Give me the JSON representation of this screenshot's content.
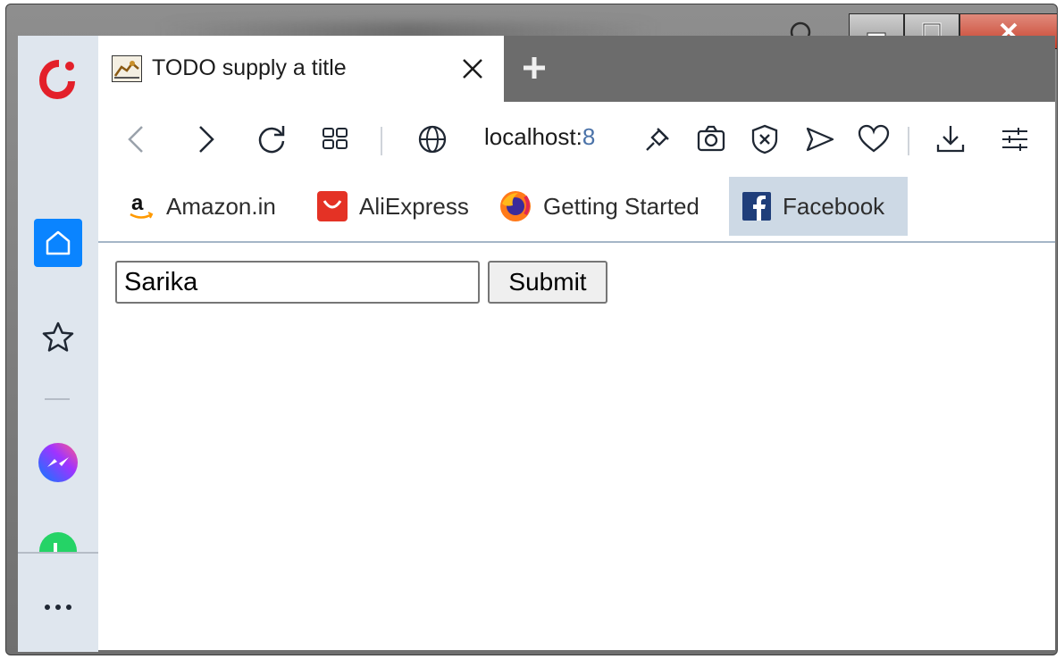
{
  "window": {
    "title": "TODO supply a title",
    "controls": [
      "minimize",
      "maximize",
      "close"
    ]
  },
  "tabs": [
    {
      "title": "TODO supply a title",
      "active": true
    }
  ],
  "sidebar": {
    "items": [
      {
        "name": "home",
        "icon": "home-icon",
        "active": true
      },
      {
        "name": "favorites",
        "icon": "star-icon"
      },
      {
        "name": "messenger",
        "icon": "messenger-icon"
      },
      {
        "name": "whatsapp",
        "icon": "whatsapp-icon"
      },
      {
        "name": "more",
        "icon": "more-icon"
      }
    ]
  },
  "toolbar": {
    "url": "localhost:",
    "url_port": "8",
    "icons": [
      "back-icon",
      "forward-icon",
      "reload-icon",
      "tabs-grid-icon",
      "globe-icon",
      "pin-icon",
      "camera-icon",
      "adblock-icon",
      "send-icon",
      "heart-icon",
      "download-icon",
      "settings-icon"
    ]
  },
  "bookmarks": [
    {
      "label": "Amazon.in",
      "icon": "amazon-icon"
    },
    {
      "label": "AliExpress",
      "icon": "aliexpress-icon"
    },
    {
      "label": "Getting Started",
      "icon": "firefox-icon"
    },
    {
      "label": "Facebook",
      "icon": "facebook-icon",
      "active": true
    }
  ],
  "page": {
    "input_value": "Sarika",
    "submit_label": "Submit"
  },
  "colors": {
    "accent": "#0a84ff",
    "sidebar_bg": "#dfe6ee",
    "close_button": "#c7402b",
    "active_bookmark_bg": "#cdd9e5"
  }
}
